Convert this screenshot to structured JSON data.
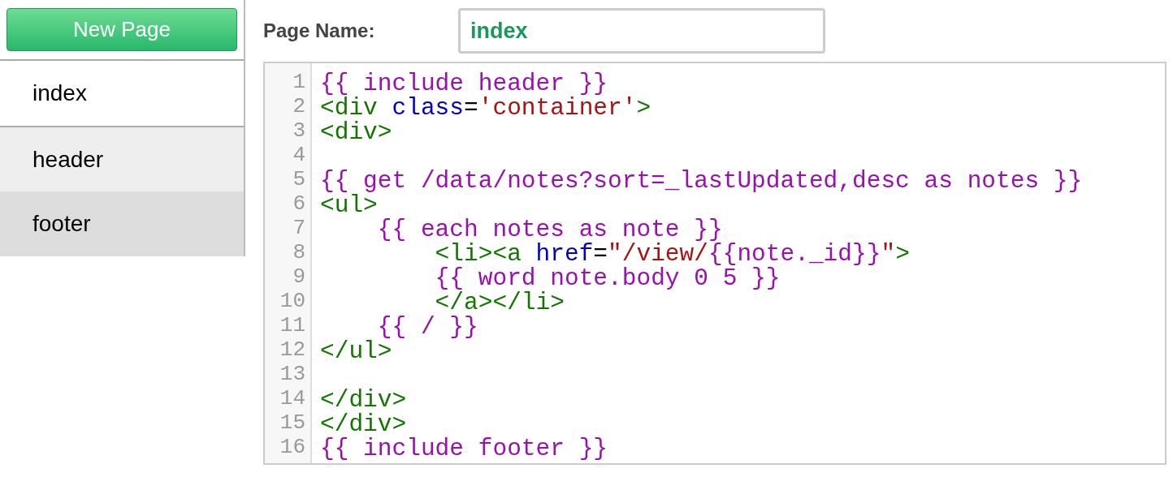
{
  "sidebar": {
    "new_button": "New Page",
    "pages": [
      {
        "label": "index",
        "selected": true,
        "highlighted": false
      },
      {
        "label": "header",
        "selected": false,
        "highlighted": false
      },
      {
        "label": "footer",
        "selected": false,
        "highlighted": true
      }
    ]
  },
  "page_name": {
    "label": "Page Name:",
    "value": "index"
  },
  "editor": {
    "lines": [
      {
        "number": "1",
        "tokens": [
          {
            "kind": "template",
            "text": "{{ include header }}"
          }
        ]
      },
      {
        "number": "2",
        "tokens": [
          {
            "kind": "tag",
            "text": "<div "
          },
          {
            "kind": "attr",
            "text": "class"
          },
          {
            "kind": "plain",
            "text": "="
          },
          {
            "kind": "string",
            "text": "'container'"
          },
          {
            "kind": "tag",
            "text": ">"
          }
        ]
      },
      {
        "number": "3",
        "tokens": [
          {
            "kind": "tag",
            "text": "<div>"
          }
        ]
      },
      {
        "number": "4"
      },
      {
        "number": "5",
        "tokens": [
          {
            "kind": "template",
            "text": "{{ get /data/notes?sort=_lastUpdated,desc as notes }}"
          }
        ]
      },
      {
        "number": "6",
        "tokens": [
          {
            "kind": "tag",
            "text": "<ul>"
          }
        ]
      },
      {
        "number": "7",
        "tokens": [
          {
            "kind": "template",
            "text": "    {{ each notes as note }}"
          }
        ]
      },
      {
        "number": "8",
        "tokens": [
          {
            "kind": "tag",
            "text": "        <li><a "
          },
          {
            "kind": "attr",
            "text": "href"
          },
          {
            "kind": "plain",
            "text": "="
          },
          {
            "kind": "string",
            "text": "\"/view/"
          },
          {
            "kind": "template",
            "text": "{{note._id}}"
          },
          {
            "kind": "string",
            "text": "\""
          },
          {
            "kind": "tag",
            "text": ">"
          }
        ]
      },
      {
        "number": "9",
        "tokens": [
          {
            "kind": "template",
            "text": "        {{ word note.body 0 5 }}"
          }
        ]
      },
      {
        "number": "10",
        "tokens": [
          {
            "kind": "tag",
            "text": "        </a></li>"
          }
        ]
      },
      {
        "number": "11",
        "tokens": [
          {
            "kind": "template",
            "text": "    {{ / }}"
          }
        ]
      },
      {
        "number": "12",
        "tokens": [
          {
            "kind": "tag",
            "text": "</ul>"
          }
        ]
      },
      {
        "number": "13"
      },
      {
        "number": "14",
        "tokens": [
          {
            "kind": "tag",
            "text": "</div>"
          }
        ]
      },
      {
        "number": "15",
        "tokens": [
          {
            "kind": "tag",
            "text": "</div>"
          }
        ]
      },
      {
        "number": "16",
        "tokens": [
          {
            "kind": "template",
            "text": "{{ include footer }}"
          }
        ]
      }
    ]
  }
}
